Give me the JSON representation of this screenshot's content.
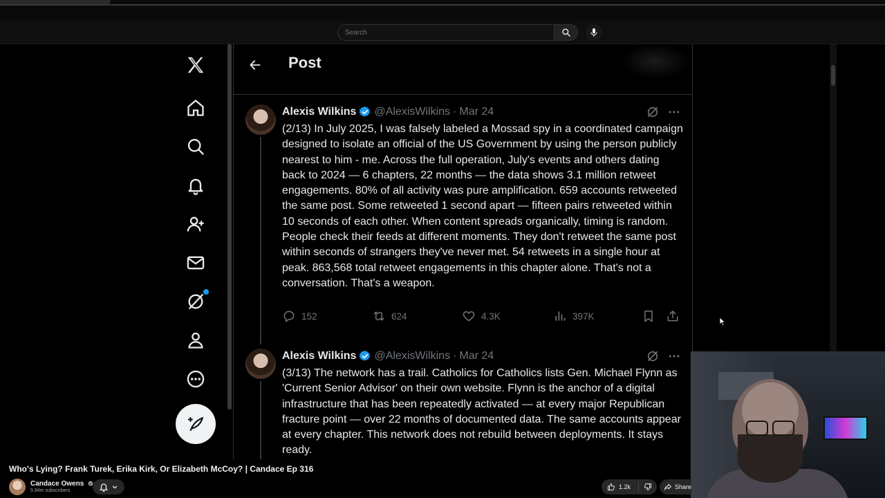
{
  "youtube": {
    "search_placeholder": "Search",
    "video_title": "Who's Lying? Frank Turek, Erika Kirk, Or Elizabeth McCoy? | Candace Ep 316",
    "channel_name": "Candace Owens",
    "subscribers": "5.94m subscribers",
    "likes": "1.2k",
    "share_label": "Share"
  },
  "x": {
    "page_title": "Post",
    "nav_items": [
      "x-logo",
      "home",
      "explore",
      "notifications",
      "communities",
      "messages",
      "grok",
      "profile",
      "more"
    ],
    "tweets": [
      {
        "name": "Alexis Wilkins",
        "handle": "@AlexisWilkins",
        "sep": "·",
        "date": "Mar 24",
        "text": "(2/13) In July 2025, I was falsely labeled a Mossad spy in a coordinated campaign designed to isolate an official of the US Government by using the person publicly nearest to him - me. Across the full operation, July's events and others dating back to 2024 — 6 chapters, 22 months — the data shows 3.1 million retweet engagements. 80% of all activity was pure amplification. 659 accounts retweeted the same post. Some retweeted 1 second apart — fifteen pairs retweeted within 10 seconds of each other. When content spreads organically, timing is random. People check their feeds at different moments. They don't retweet the same post within seconds of strangers they've never met. 54 retweets in a single hour at peak. 863,568 total retweet engagements in this chapter alone. That's not a conversation. That's a weapon.",
        "replies": "152",
        "retweets": "624",
        "likes": "4.3K",
        "views": "397K"
      },
      {
        "name": "Alexis Wilkins",
        "handle": "@AlexisWilkins",
        "sep": "·",
        "date": "Mar 24",
        "text": "(3/13) The network has a trail. Catholics for Catholics lists Gen. Michael Flynn as 'Current Senior Advisor' on their own website. Flynn is the anchor of a digital infrastructure that has been repeatedly activated — at every major Republican fracture point — over 22 months of documented data. The same accounts appear at every chapter. This network does not rebuild between deployments. It stays ready."
      }
    ]
  },
  "colors": {
    "accent": "#1d9bf0",
    "muted": "#71767b",
    "text": "#e7e9ea",
    "border": "#2f3336"
  }
}
